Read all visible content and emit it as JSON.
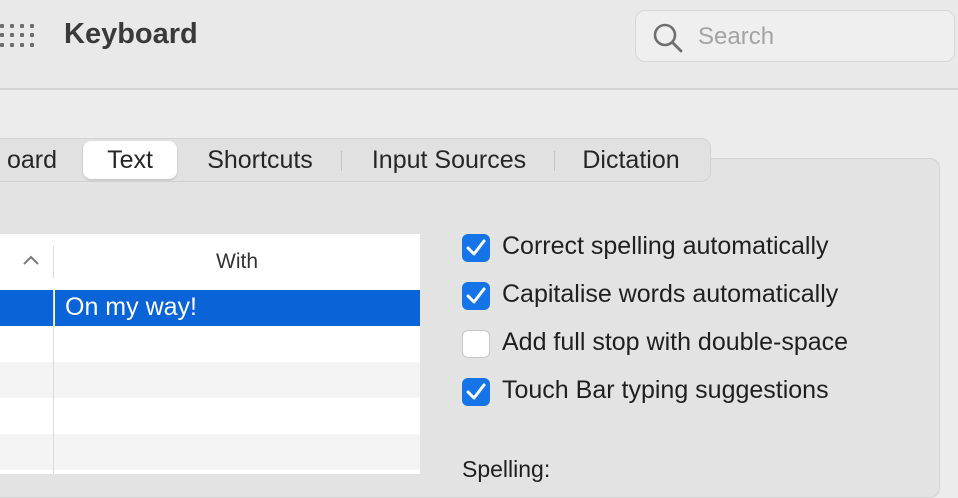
{
  "window": {
    "title": "Keyboard"
  },
  "search": {
    "placeholder": "Search"
  },
  "tabs": [
    {
      "label": "oard",
      "active": false
    },
    {
      "label": "Text",
      "active": true
    },
    {
      "label": "Shortcuts",
      "active": false
    },
    {
      "label": "Input Sources",
      "active": false
    },
    {
      "label": "Dictation",
      "active": false
    }
  ],
  "table": {
    "column_with": "With",
    "rows": [
      {
        "with": "On my way!",
        "selected": true
      },
      {
        "with": ""
      },
      {
        "with": ""
      },
      {
        "with": ""
      },
      {
        "with": ""
      }
    ]
  },
  "options": [
    {
      "label": "Correct spelling automatically",
      "checked": true
    },
    {
      "label": "Capitalise words automatically",
      "checked": true
    },
    {
      "label": "Add full stop with double-space",
      "checked": false
    },
    {
      "label": "Touch Bar typing suggestions",
      "checked": true
    }
  ],
  "spelling": {
    "label": "Spelling:"
  },
  "colors": {
    "accent": "#1574e8",
    "selection": "#0b63d8"
  }
}
